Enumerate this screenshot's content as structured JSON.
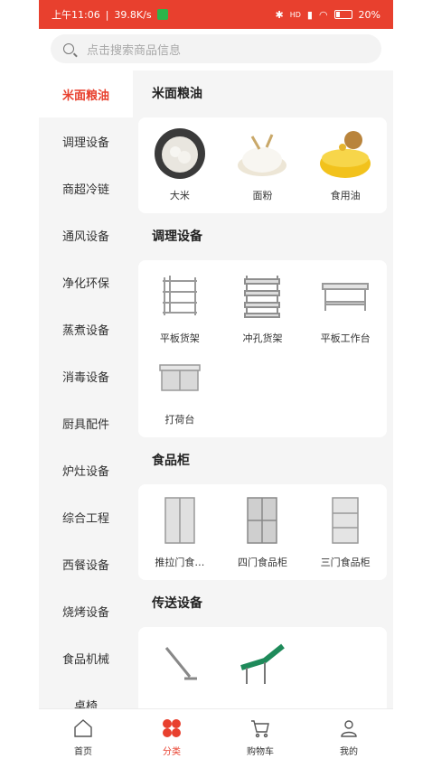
{
  "status_bar": {
    "time": "上午11:06",
    "net_speed": "39.8K/s",
    "signal": "HD",
    "battery": "20%",
    "color": "#e8402e"
  },
  "search": {
    "placeholder": "点击搜索商品信息"
  },
  "sidebar": {
    "items": [
      {
        "label": "米面粮油",
        "active": true
      },
      {
        "label": "调理设备"
      },
      {
        "label": "商超冷链"
      },
      {
        "label": "通风设备"
      },
      {
        "label": "净化环保"
      },
      {
        "label": "蒸煮设备"
      },
      {
        "label": "消毒设备"
      },
      {
        "label": "厨具配件"
      },
      {
        "label": "炉灶设备"
      },
      {
        "label": "综合工程"
      },
      {
        "label": "西餐设备"
      },
      {
        "label": "烧烤设备"
      },
      {
        "label": "食品机械"
      },
      {
        "label": "桌椅"
      }
    ]
  },
  "sections": [
    {
      "title": "米面粮油",
      "products": [
        {
          "name": "大米",
          "icon": "rice-image"
        },
        {
          "name": "面粉",
          "icon": "flour-image"
        },
        {
          "name": "食用油",
          "icon": "oil-image"
        }
      ]
    },
    {
      "title": "调理设备",
      "products": [
        {
          "name": "平板货架",
          "icon": "flat-shelf-image"
        },
        {
          "name": "冲孔货架",
          "icon": "punched-shelf-image"
        },
        {
          "name": "平板工作台",
          "icon": "workbench-image"
        },
        {
          "name": "打荷台",
          "icon": "cabinet-bench-image"
        }
      ]
    },
    {
      "title": "食品柜",
      "products": [
        {
          "name": "推拉门食…",
          "icon": "sliding-cabinet-image"
        },
        {
          "name": "四门食品柜",
          "icon": "four-door-cabinet-image"
        },
        {
          "name": "三门食品柜",
          "icon": "three-door-cabinet-image"
        }
      ]
    },
    {
      "title": "传送设备",
      "products": [
        {
          "name": "",
          "icon": "screw-conveyor-image"
        },
        {
          "name": "",
          "icon": "belt-conveyor-image"
        }
      ]
    }
  ],
  "tabbar": {
    "items": [
      {
        "label": "首页",
        "icon": "home-icon"
      },
      {
        "label": "分类",
        "icon": "category-icon",
        "active": true
      },
      {
        "label": "购物车",
        "icon": "cart-icon"
      },
      {
        "label": "我的",
        "icon": "profile-icon"
      }
    ]
  }
}
